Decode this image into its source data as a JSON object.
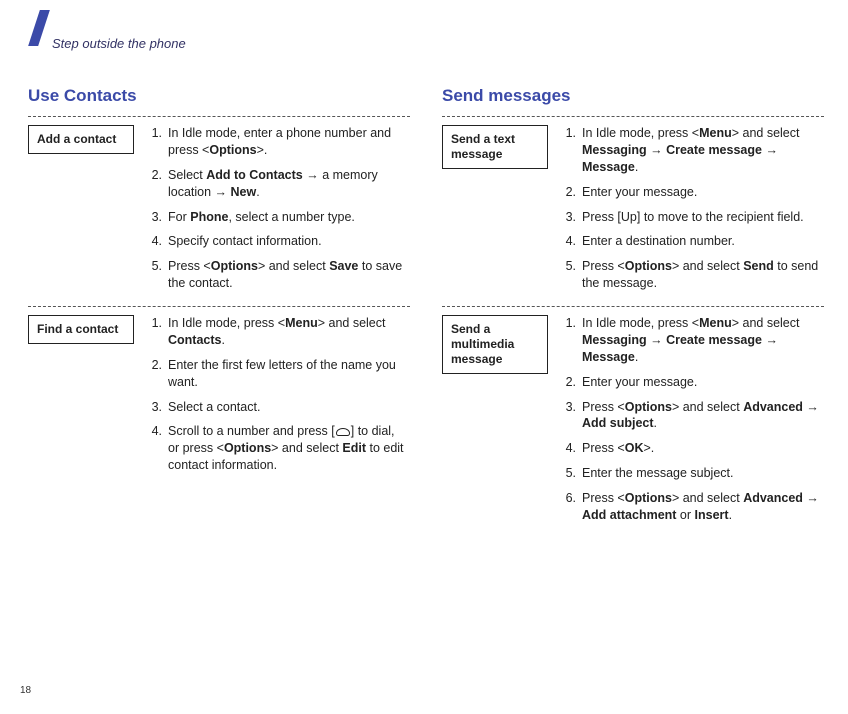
{
  "breadcrumb": "Step outside the phone",
  "page_number": "18",
  "left": {
    "title": "Use Contacts",
    "sections": [
      {
        "label": "Add a contact",
        "steps": [
          {
            "n": "1.",
            "html": "In Idle mode, enter a phone number and press <<b>Options</b>>."
          },
          {
            "n": "2.",
            "html": "Select <b>Add to Contacts</b> → a memory location → <b>New</b>."
          },
          {
            "n": "3.",
            "html": "For <b>Phone</b>, select a number type."
          },
          {
            "n": "4.",
            "html": "Specify contact information."
          },
          {
            "n": "5.",
            "html": "Press <<b>Options</b>> and select <b>Save</b> to save the contact."
          }
        ]
      },
      {
        "label": "Find a contact",
        "steps": [
          {
            "n": "1.",
            "html": "In Idle mode, press <<b>Menu</b>> and select <b>Contacts</b>."
          },
          {
            "n": "2.",
            "html": "Enter the first few letters of the name you want."
          },
          {
            "n": "3.",
            "html": "Select a contact."
          },
          {
            "n": "4.",
            "html": "Scroll to a number and press [<span class=\"call-icon\"></span>] to dial, or press <<b>Options</b>> and select <b>Edit</b> to edit contact information."
          }
        ]
      }
    ]
  },
  "right": {
    "title": "Send messages",
    "sections": [
      {
        "label": "Send a text message",
        "steps": [
          {
            "n": "1.",
            "html": "In Idle mode, press <<b>Menu</b>> and select <b>Messaging</b> → <b>Create message</b> → <b>Message</b>."
          },
          {
            "n": "2.",
            "html": "Enter your message."
          },
          {
            "n": "3.",
            "html": "Press [Up] to move to the recipient field."
          },
          {
            "n": "4.",
            "html": "Enter a destination number."
          },
          {
            "n": "5.",
            "html": "Press <<b>Options</b>> and select <b>Send</b> to send the message."
          }
        ]
      },
      {
        "label": "Send a multimedia message",
        "steps": [
          {
            "n": "1.",
            "html": "In Idle mode, press <<b>Menu</b>> and select <b>Messaging</b> → <b>Create message</b> → <b>Message</b>."
          },
          {
            "n": "2.",
            "html": "Enter your message."
          },
          {
            "n": "3.",
            "html": "Press <<b>Options</b>> and select <b>Advanced</b> → <b>Add subject</b>."
          },
          {
            "n": "4.",
            "html": "Press <<b>OK</b>>."
          },
          {
            "n": "5.",
            "html": "Enter the message subject."
          },
          {
            "n": "6.",
            "html": "Press <<b>Options</b>> and select <b>Advanced</b> → <b>Add attachment</b> or <b>Insert</b>."
          }
        ]
      }
    ]
  }
}
